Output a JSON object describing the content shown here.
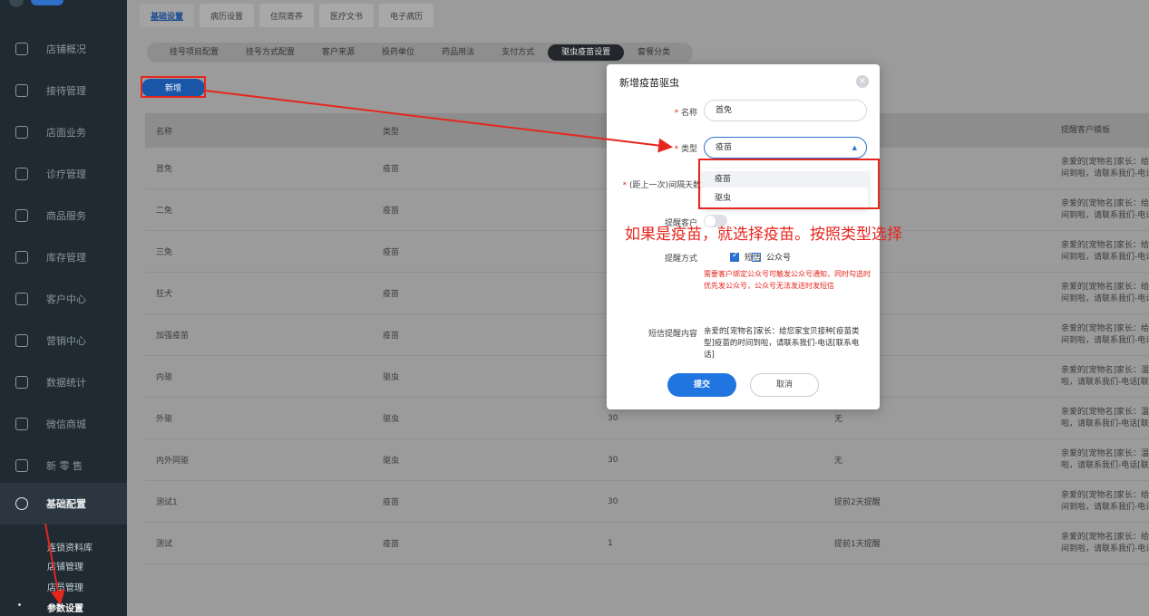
{
  "sidebar": {
    "items": [
      {
        "label": "店铺概况",
        "icon": "store-icon"
      },
      {
        "label": "接待管理",
        "icon": "reception-icon"
      },
      {
        "label": "店面业务",
        "icon": "business-icon"
      },
      {
        "label": "诊疗管理",
        "icon": "medical-icon"
      },
      {
        "label": "商品服务",
        "icon": "goods-icon"
      },
      {
        "label": "库存管理",
        "icon": "inventory-icon"
      },
      {
        "label": "客户中心",
        "icon": "customer-icon"
      },
      {
        "label": "营销中心",
        "icon": "marketing-icon"
      },
      {
        "label": "数据统计",
        "icon": "stats-icon"
      },
      {
        "label": "微信商城",
        "icon": "wechat-icon"
      },
      {
        "label": "新 零 售",
        "icon": "retail-icon"
      },
      {
        "label": "基础配置",
        "icon": "config-icon"
      }
    ],
    "sub_items": [
      "连锁资料库",
      "店铺管理",
      "店员管理",
      "参数设置"
    ]
  },
  "top_tabs": [
    "基础设置",
    "病历设置",
    "住院寄养",
    "医疗文书",
    "电子病历"
  ],
  "sub_tabs": [
    "挂号项目配置",
    "挂号方式配置",
    "客户来源",
    "投药单位",
    "药品用法",
    "支付方式",
    "驱虫疫苗设置",
    "套餐分类"
  ],
  "add_button": "新增",
  "table": {
    "headers": [
      "名称",
      "类型",
      "",
      "",
      "提醒客户模板"
    ],
    "rows": [
      {
        "name": "首免",
        "type": "疫苗",
        "days": "",
        "remind": "",
        "tpl1": "亲爱的[宠物名]家长：给您",
        "tpl2": "间到啦，请联系我们-电话"
      },
      {
        "name": "二免",
        "type": "疫苗",
        "days": "",
        "remind": "",
        "tpl1": "亲爱的[宠物名]家长：给您",
        "tpl2": "间到啦，请联系我们-电话"
      },
      {
        "name": "三免",
        "type": "疫苗",
        "days": "",
        "remind": "",
        "tpl1": "亲爱的[宠物名]家长：给您",
        "tpl2": "间到啦，请联系我们-电话"
      },
      {
        "name": "狂犬",
        "type": "疫苗",
        "days": "",
        "remind": "",
        "tpl1": "亲爱的[宠物名]家长：给您",
        "tpl2": "间到啦，请联系我们-电话"
      },
      {
        "name": "加强疫苗",
        "type": "疫苗",
        "days": "",
        "remind": "",
        "tpl1": "亲爱的[宠物名]家长：给您",
        "tpl2": "间到啦，请联系我们-电话"
      },
      {
        "name": "内驱",
        "type": "驱虫",
        "days": "",
        "remind": "",
        "tpl1": "亲爱的[宠物名]家长：温馨",
        "tpl2": "啦，请联系我们-电话[联"
      },
      {
        "name": "外驱",
        "type": "驱虫",
        "days": "30",
        "remind": "无",
        "tpl1": "亲爱的[宠物名]家长：温馨",
        "tpl2": "啦，请联系我们-电话[联"
      },
      {
        "name": "内外同驱",
        "type": "驱虫",
        "days": "30",
        "remind": "无",
        "tpl1": "亲爱的[宠物名]家长：温馨",
        "tpl2": "啦，请联系我们-电话[联"
      },
      {
        "name": "测试1",
        "type": "疫苗",
        "days": "30",
        "remind": "提前2天提醒",
        "tpl1": "亲爱的[宠物名]家长：给您",
        "tpl2": "间到啦，请联系我们-电话"
      },
      {
        "name": "测试",
        "type": "疫苗",
        "days": "1",
        "remind": "提前1天提醒",
        "tpl1": "亲爱的[宠物名]家长：给您",
        "tpl2": "间到啦，请联系我们-电话"
      }
    ]
  },
  "modal": {
    "title": "新增疫苗驱虫",
    "close_icon": "×",
    "name_label": "名称",
    "name_value": "首免",
    "type_label": "类型",
    "type_value": "疫苗",
    "type_options": [
      "疫苗",
      "驱虫"
    ],
    "interval_label": "(距上一次)间隔天数",
    "remind_label": "提醒客户",
    "method_label": "提醒方式",
    "method_sms": "短信",
    "method_official": "公众号",
    "warning": "需要客户绑定公众号可触发公众号通知，同时勾选时优先发公众号，公众号无法发送时发短信",
    "sms_label": "短信提醒内容",
    "sms_content": "亲爱的[宠物名]家长：给您家宝贝接种[疫苗类型]疫苗的时间到啦，请联系我们-电话[联系电话]",
    "submit": "提交",
    "cancel": "取消"
  },
  "annotation": "如果是疫苗，就选择疫苗。按照类型选择",
  "colors": {
    "accent": "#2175e0",
    "annotation_red": "#e5261e",
    "sidebar_bg": "#1f2a33"
  }
}
